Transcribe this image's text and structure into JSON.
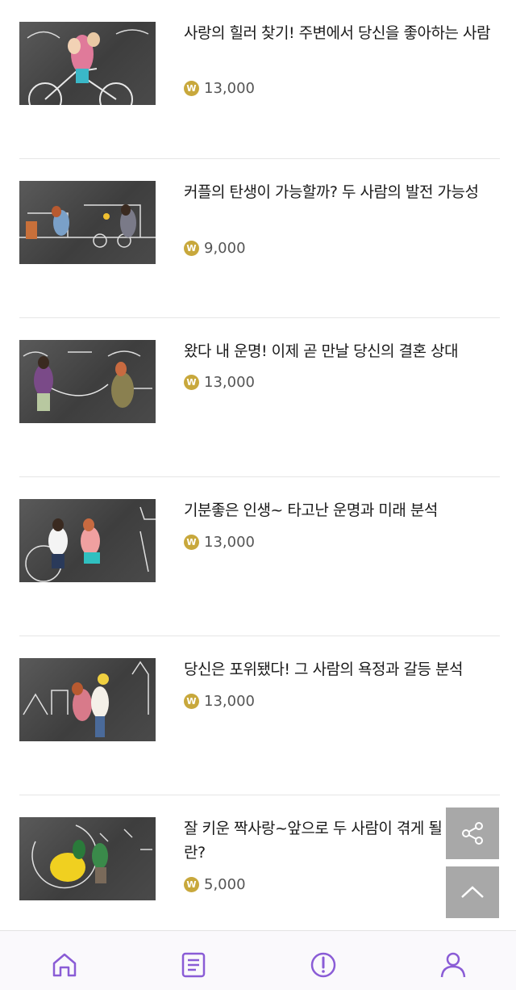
{
  "products": [
    {
      "title": "사랑의 힐러 찾기! 주변에서 당신을 좋아하는 사람",
      "price": "13,000",
      "image_icon": "couple-bicycle-chalkboard-image"
    },
    {
      "title": "커플의 탄생이 가능할까? 두 사람의 발전 가능성",
      "price": "9,000",
      "image_icon": "couple-train-chalkboard-image"
    },
    {
      "title": "왔다 내 운명! 이제 곧 만날 당신의 결혼 상대",
      "price": "13,000",
      "image_icon": "couple-rope-chalkboard-image"
    },
    {
      "title": "기분좋은 인생~ 타고난 운명과 미래 분석",
      "price": "13,000",
      "image_icon": "couple-tandem-chalkboard-image"
    },
    {
      "title": "당신은 포위됐다! 그 사람의 욕정과 갈등 분석",
      "price": "13,000",
      "image_icon": "couple-flowers-chalkboard-image"
    },
    {
      "title": "잘 키운 짝사랑~앞으로 두 사람이 겪게 될 사건이란?",
      "price": "5,000",
      "image_icon": "couple-moon-chalkboard-image"
    }
  ],
  "currency_badge": "W",
  "floating": {
    "share_icon": "share-icon",
    "top_icon": "chevron-up-icon"
  },
  "nav": [
    {
      "icon": "home-icon"
    },
    {
      "icon": "list-document-icon"
    },
    {
      "icon": "alert-circle-icon"
    },
    {
      "icon": "user-icon"
    }
  ],
  "colors": {
    "accent": "#8a5cd6",
    "coin": "#c8a83c",
    "float": "#a8a8a8"
  }
}
